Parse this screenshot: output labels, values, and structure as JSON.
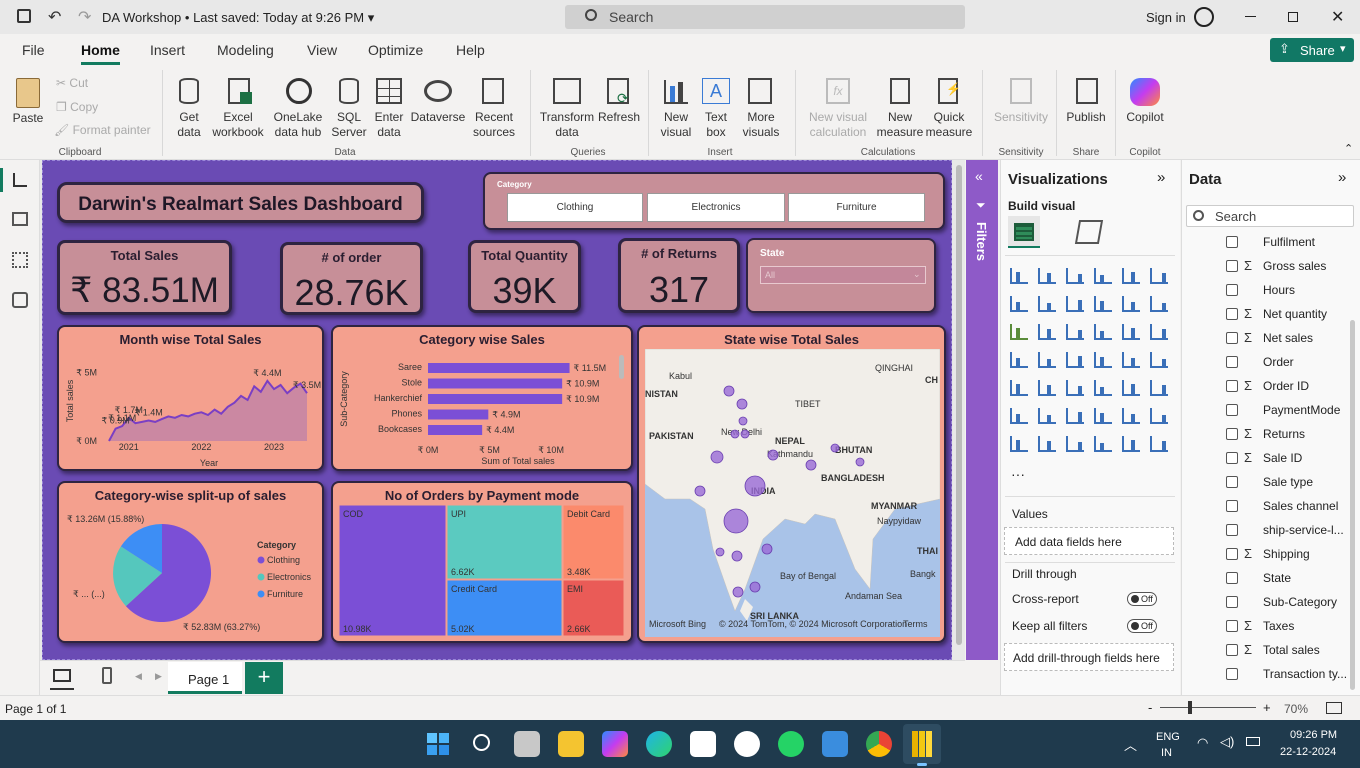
{
  "titlebar": {
    "doc": "DA Workshop",
    "sep": "•",
    "saved": "Last saved: Today at 9:26 PM",
    "search": "Search",
    "signin": "Sign in"
  },
  "menu": {
    "file": "File",
    "home": "Home",
    "insert": "Insert",
    "modeling": "Modeling",
    "view": "View",
    "optimize": "Optimize",
    "help": "Help",
    "share": "Share"
  },
  "ribbon": {
    "paste": "Paste",
    "cut": "Cut",
    "copy": "Copy",
    "format_painter": "Format painter",
    "clipboard": "Clipboard",
    "get_data": "Get data",
    "excel": "Excel workbook",
    "onelake": "OneLake data hub",
    "sql": "SQL Server",
    "enter_data": "Enter data",
    "dataverse": "Dataverse",
    "recent": "Recent sources",
    "data": "Data",
    "transform": "Transform data",
    "refresh": "Refresh",
    "queries": "Queries",
    "new_visual": "New visual",
    "text_box": "Text box",
    "more_visuals": "More visuals",
    "insert": "Insert",
    "new_calc": "New visual calculation",
    "new_measure": "New measure",
    "quick_measure": "Quick measure",
    "calculations": "Calculations",
    "sensitivity": "Sensitivity",
    "sensitivity_group": "Sensitivity",
    "publish": "Publish",
    "share_group": "Share",
    "copilot": "Copilot",
    "copilot_group": "Copilot"
  },
  "dashboard": {
    "title": "Darwin's Realmart Sales Dashboard",
    "category_slicer": {
      "label": "Category",
      "options": [
        "Clothing",
        "Electronics",
        "Furniture"
      ]
    },
    "state_slicer": {
      "label": "State",
      "value": "All"
    },
    "kpis": [
      {
        "label": "Total Sales",
        "value": "₹ 83.51M"
      },
      {
        "label": "# of order",
        "value": "28.76K"
      },
      {
        "label": "Total Quantity",
        "value": "39K"
      },
      {
        "label": "# of Returns",
        "value": "317"
      }
    ],
    "month_chart": {
      "title": "Month wise Total Sales",
      "ylabel": "Total sales",
      "xlabel": "Year"
    },
    "category_bar": {
      "title": "Category wise Sales",
      "ylabel": "Sub-Category",
      "xlabel": "Sum of Total sales"
    },
    "map": {
      "title": "State wise Total Sales",
      "labels": [
        "Kabul",
        "NISTAN",
        "PAKISTAN",
        "New Delhi",
        "NEPAL",
        "Kathmandu",
        "BHUTAN",
        "BANGLADESH",
        "INDIA",
        "MYANMAR",
        "Naypyidaw",
        "THAI",
        "Bangk",
        "Bay of Bengal",
        "Andaman Sea",
        "SRI LANKA",
        "TIBET",
        "QINGHAI",
        "CH"
      ],
      "attribution": "© 2024 TomTom, © 2024 Microsoft Corporation",
      "terms": "Terms",
      "logo": "Microsoft Bing"
    },
    "pie": {
      "title": "Category-wise split-up of sales",
      "legend_title": "Category"
    },
    "treemap": {
      "title": "No of Orders by Payment mode"
    }
  },
  "chart_data": [
    {
      "type": "area",
      "title": "Month wise Total Sales",
      "xlabel": "Year",
      "ylabel": "Total sales",
      "x_ticks": [
        "2021",
        "2022",
        "2023"
      ],
      "y_ticks": [
        "₹ 0M",
        "₹ 5M"
      ],
      "values": [
        0.0,
        0.9,
        1.1,
        1.7,
        1.3,
        1.4,
        1.5,
        1.4,
        1.6,
        1.8,
        1.7,
        1.9,
        1.8,
        2.0,
        2.1,
        1.9,
        2.3,
        2.0,
        2.5,
        2.8,
        3.3,
        3.0,
        4.0,
        3.6,
        4.4,
        3.8,
        4.1,
        3.5,
        3.9,
        4.2,
        3.5
      ],
      "data_labels": [
        {
          "index": 1,
          "text": "₹ 0.9M"
        },
        {
          "index": 2,
          "text": "₹ 1.1M"
        },
        {
          "index": 3,
          "text": "₹ 1.7M"
        },
        {
          "index": 6,
          "text": "₹ 1.4M"
        },
        {
          "index": 24,
          "text": "₹ 4.4M"
        },
        {
          "index": 30,
          "text": "₹ 3.5M"
        }
      ],
      "ylim": [
        0,
        6
      ]
    },
    {
      "type": "bar",
      "title": "Category wise Sales",
      "xlabel": "Sum of Total sales",
      "ylabel": "Sub-Category",
      "categories": [
        "Saree",
        "Stole",
        "Hankerchief",
        "Phones",
        "Bookcases"
      ],
      "values": [
        11.5,
        10.9,
        10.9,
        4.9,
        4.4
      ],
      "labels": [
        "₹ 11.5M",
        "₹ 10.9M",
        "₹ 10.9M",
        "₹ 4.9M",
        "₹ 4.4M"
      ],
      "x_ticks": [
        "₹ 0M",
        "₹ 5M",
        "₹ 10M"
      ],
      "xlim": [
        0,
        13
      ]
    },
    {
      "type": "pie",
      "title": "Category-wise split-up of sales",
      "categories": [
        "Clothing",
        "Electronics",
        "Furniture"
      ],
      "values": [
        52.83,
        17.5,
        13.26
      ],
      "colors": [
        "#7b4fd6",
        "#55c7bd",
        "#3d8ef5"
      ],
      "labels": [
        "₹ 52.83M (63.27%)",
        "₹ ... (...)",
        "₹ 13.26M (15.88%)"
      ]
    },
    {
      "type": "treemap",
      "title": "No of Orders by Payment mode",
      "categories": [
        "COD",
        "UPI",
        "Debit Card",
        "Credit Card",
        "EMI"
      ],
      "values": [
        10.98,
        6.62,
        3.48,
        5.02,
        2.66
      ],
      "labels": [
        "10.98K",
        "6.62K",
        "3.48K",
        "5.02K",
        "2.66K"
      ],
      "colors": [
        "#7b4fd6",
        "#5bcac0",
        "#fb8a6c",
        "#3d8ef5",
        "#ea5b57"
      ]
    }
  ],
  "visualizations": {
    "title": "Visualizations",
    "build": "Build visual",
    "values": "Values",
    "add_data": "Add data fields here",
    "drill": "Drill through",
    "cross": "Cross-report",
    "keep": "Keep all filters",
    "off": "Off",
    "add_drill": "Add drill-through fields here"
  },
  "filters_label": "Filters",
  "data_pane": {
    "title": "Data",
    "search": "Search",
    "fields": [
      {
        "name": "Fulfilment",
        "sigma": false
      },
      {
        "name": "Gross sales",
        "sigma": true
      },
      {
        "name": "Hours",
        "sigma": false
      },
      {
        "name": "Net quantity",
        "sigma": true
      },
      {
        "name": "Net sales",
        "sigma": true
      },
      {
        "name": "Order",
        "sigma": false
      },
      {
        "name": "Order ID",
        "sigma": true
      },
      {
        "name": "PaymentMode",
        "sigma": false
      },
      {
        "name": "Returns",
        "sigma": true
      },
      {
        "name": "Sale ID",
        "sigma": true
      },
      {
        "name": "Sale type",
        "sigma": false
      },
      {
        "name": "Sales channel",
        "sigma": false
      },
      {
        "name": "ship-service-l...",
        "sigma": false
      },
      {
        "name": "Shipping",
        "sigma": true
      },
      {
        "name": "State",
        "sigma": false
      },
      {
        "name": "Sub-Category",
        "sigma": false
      },
      {
        "name": "Taxes",
        "sigma": true
      },
      {
        "name": "Total sales",
        "sigma": true
      },
      {
        "name": "Transaction ty...",
        "sigma": false
      }
    ]
  },
  "pagebar": {
    "page1": "Page 1",
    "add": "+"
  },
  "status": {
    "page": "Page 1 of 1",
    "zoom": "70%"
  },
  "taskbar": {
    "lang1": "ENG",
    "lang2": "IN",
    "time": "09:26 PM",
    "date": "22-12-2024"
  }
}
